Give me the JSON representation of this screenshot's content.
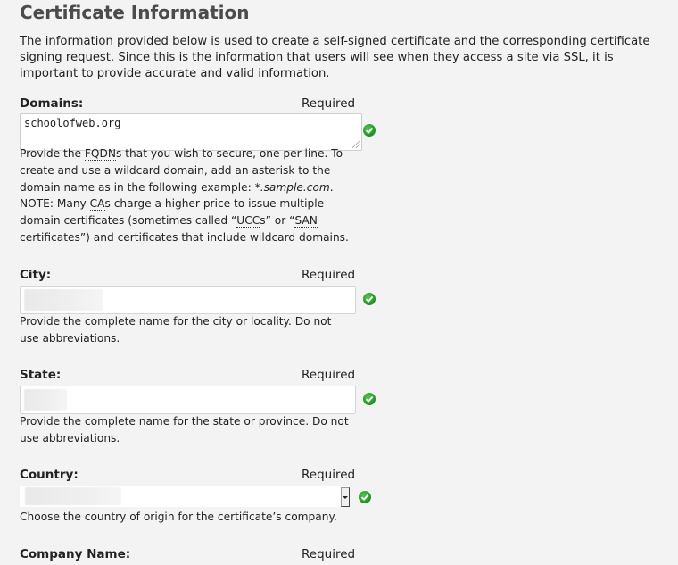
{
  "page": {
    "title": "Certificate Information",
    "intro": "The information provided below is used to create a self-signed certificate and the corresponding certificate signing request. Since this is the information that users will see when they access a site via SSL, it is important to provide accurate and valid information."
  },
  "fields": {
    "domains": {
      "label": "Domains:",
      "required": "Required",
      "value": "schoolofweb.org",
      "help": {
        "p1": "Provide the ",
        "fqdn": "FQDN",
        "p2": "s that you wish to secure, one per line. To create and use a wildcard domain, add an asterisk to the domain name as in the following example: ",
        "example": "*.sample.com",
        "p3": ". NOTE: Many ",
        "ca": "CA",
        "p4": "s charge a higher price to issue multiple-domain certificates (sometimes called “",
        "ucc": "UCC",
        "p5": "s” or “",
        "san": "SAN",
        "p6": " certificates”) and certificates that include wildcard domains."
      }
    },
    "city": {
      "label": "City:",
      "required": "Required",
      "value_redacted": true,
      "help": "Provide the complete name for the city or locality. Do not use abbreviations."
    },
    "state": {
      "label": "State:",
      "required": "Required",
      "value_redacted": true,
      "help": "Provide the complete name for the state or province. Do not use abbreviations."
    },
    "country": {
      "label": "Country:",
      "required": "Required",
      "value_redacted": true,
      "help": "Choose the country of origin for the certificate’s company."
    },
    "company": {
      "label": "Company Name:",
      "required": "Required"
    }
  },
  "icons": {
    "valid": "check-circle-icon",
    "valid_color": "#2a9d2a"
  }
}
